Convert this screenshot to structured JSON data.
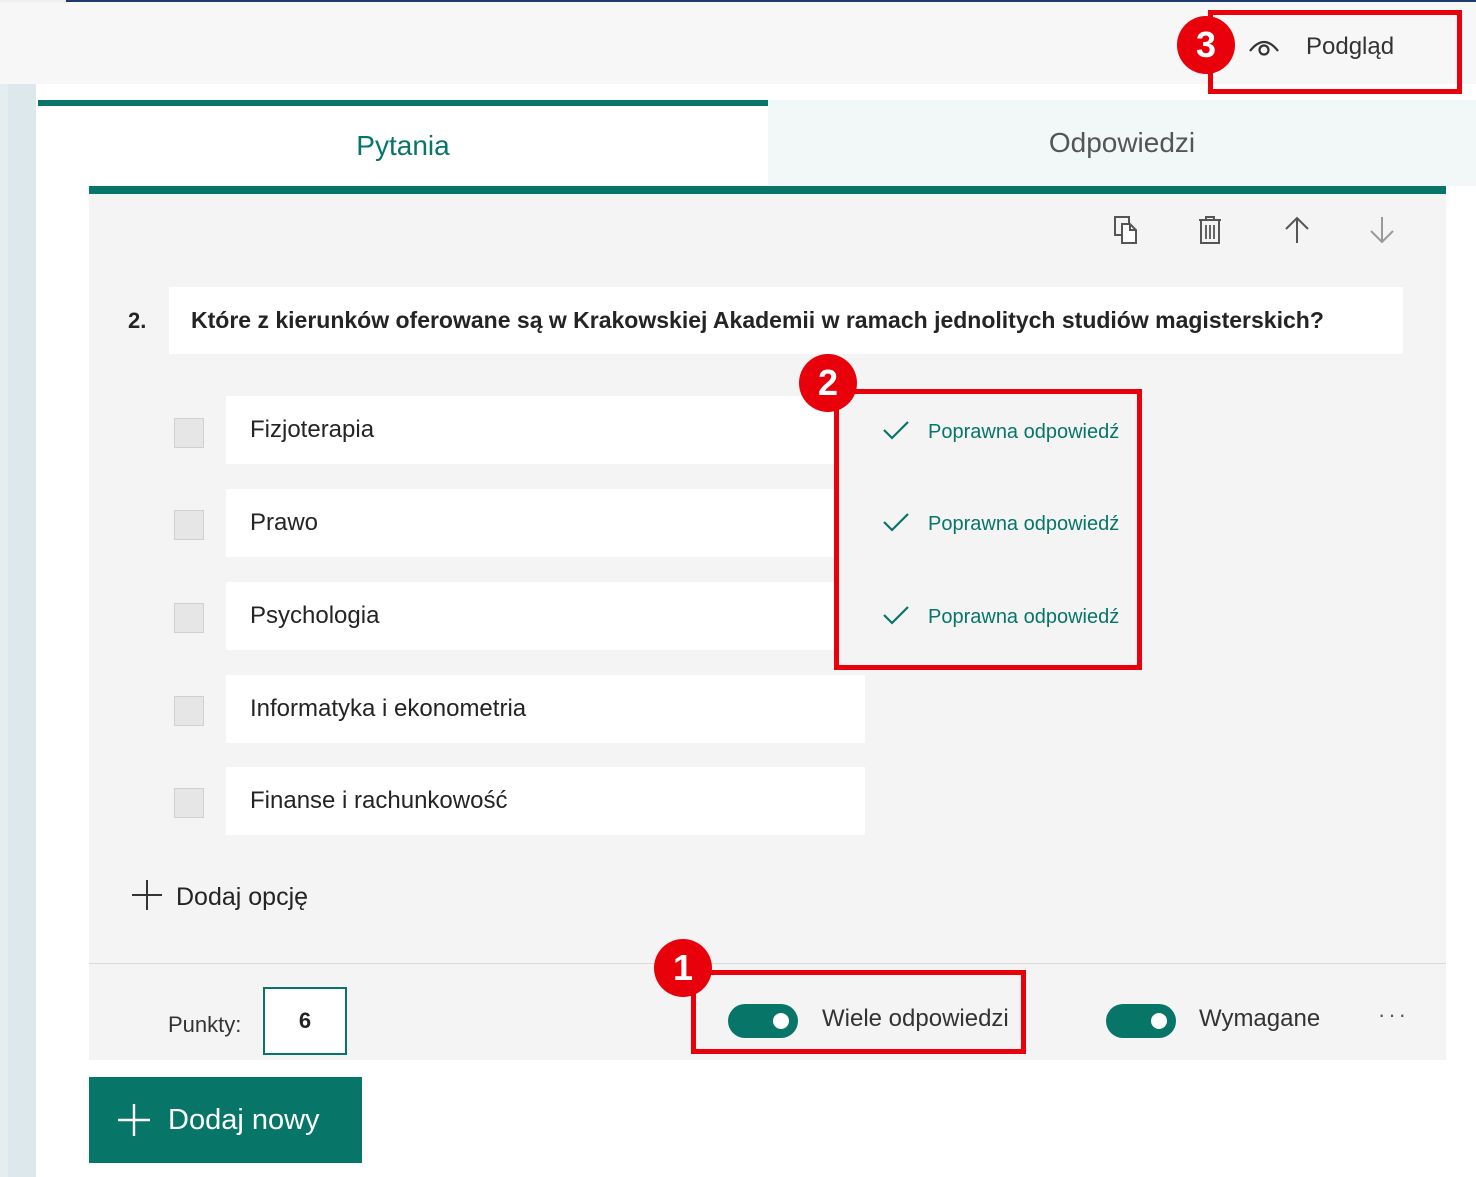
{
  "header": {
    "preview_label": "Podgląd",
    "preview_icon": "eye-icon"
  },
  "tabs": [
    {
      "label": "Pytania",
      "active": true
    },
    {
      "label": "Odpowiedzi",
      "active": false
    }
  ],
  "question": {
    "number": "2.",
    "text": "Które z kierunków oferowane są w Krakowskiej Akademii w ramach jednolitych studiów magisterskich?",
    "toolbar_icons": [
      "copy-icon",
      "trash-icon",
      "arrow-up-icon",
      "arrow-down-icon"
    ],
    "options": [
      {
        "label": "Fizjoterapia",
        "correct": true
      },
      {
        "label": "Prawo",
        "correct": true
      },
      {
        "label": "Psychologia",
        "correct": true
      },
      {
        "label": "Informatyka i ekonometria",
        "correct": false
      },
      {
        "label": "Finanse i rachunkowość",
        "correct": false
      }
    ],
    "correct_label": "Poprawna odpowiedź",
    "add_option_label": "Dodaj opcję"
  },
  "footer": {
    "points_label": "Punkty:",
    "points_value": "6",
    "multiple_answers_label": "Wiele odpowiedzi",
    "multiple_answers_on": true,
    "required_label": "Wymagane",
    "required_on": true,
    "more_label": "···"
  },
  "add_new_label": "Dodaj nowy",
  "annotations": [
    {
      "number": "1"
    },
    {
      "number": "2"
    },
    {
      "number": "3"
    }
  ],
  "colors": {
    "accent": "#077568",
    "highlight": "#e8000b"
  }
}
